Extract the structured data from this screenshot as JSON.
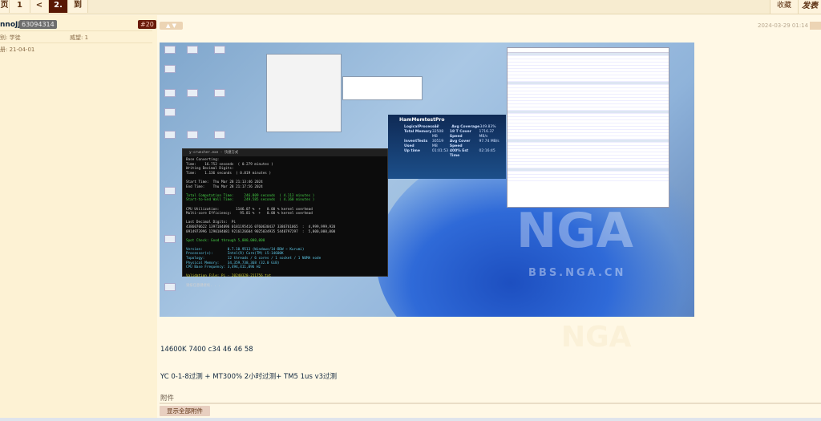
{
  "pagination": {
    "items": [
      {
        "label": "页"
      },
      {
        "label": "1"
      },
      {
        "label": "<"
      },
      {
        "label": "2.",
        "active": true
      },
      {
        "label": "到"
      }
    ]
  },
  "header_actions": {
    "favorite": "收藏",
    "post": "发表"
  },
  "post": {
    "author": {
      "name": "nnoJJ",
      "uid": "63094314",
      "rank_label": "别: 学徒",
      "prestige_label": "威望: 1",
      "reg_label": "册: 21-04-01"
    },
    "floor": "#20",
    "date": "2024-03-29 01:14",
    "image": {
      "watermark": "NGA",
      "watermark_url": "BBS.NGA.CN",
      "terminal_title": "y-cruncher.exe - 快捷方式",
      "terminal_lines": [
        {
          "t": "Base Converting:",
          "c": ""
        },
        {
          "t": "Time:    16.752 seconds  ( 0.279 minutes )",
          "c": ""
        },
        {
          "t": "Writing Decimal Digits:",
          "c": ""
        },
        {
          "t": "Time:    1.136 seconds  ( 0.019 minutes )",
          "c": ""
        },
        {
          "t": "",
          "c": ""
        },
        {
          "t": "Start Time:  Thu Mar 28 21:13:46 2024",
          "c": ""
        },
        {
          "t": "End Time:    Thu Mar 28 21:17:56 2024",
          "c": ""
        },
        {
          "t": "",
          "c": ""
        },
        {
          "t": "Total Computation Time:     246.809 seconds  ( 4.113 minutes )",
          "c": "g"
        },
        {
          "t": "Start-to-End Wall Time:     249.585 seconds  ( 4.160 minutes )",
          "c": "g"
        },
        {
          "t": "",
          "c": ""
        },
        {
          "t": "CPU Utilization:        1146.07 %  +   0.00 % kernel overhead",
          "c": ""
        },
        {
          "t": "Multi-core Efficiency:    95.81 %  +   0.00 % kernel overhead",
          "c": ""
        },
        {
          "t": "",
          "c": ""
        },
        {
          "t": "Last Decimal Digits:  Pi",
          "c": ""
        },
        {
          "t": "4386070622 1397184096 0181195416 0760630437 3386761065  :  4,999,999,920",
          "c": ""
        },
        {
          "t": "0914973996 1290184081 9216126604 9025034935 5440797297  :  5,000,000,000",
          "c": ""
        },
        {
          "t": "",
          "c": ""
        },
        {
          "t": "Spot Check: Good through 5,000,000,000",
          "c": "g"
        },
        {
          "t": "",
          "c": ""
        },
        {
          "t": "Version:            0.7.10.9513 (Windows/14-BDW ~ Kurumi)",
          "c": "c"
        },
        {
          "t": "Processor(s):       Intel(R) Core(TM) i5-14600K",
          "c": "c"
        },
        {
          "t": "Topology:           12 threads / 6 cores / 1 socket / 1 NUMA node",
          "c": "c"
        },
        {
          "t": "Physical Memory:    34,359,738,368 (32.0 GiB)",
          "c": "c"
        },
        {
          "t": "CPU Base Frequency: 3,494,411,096 Hz",
          "c": "c"
        },
        {
          "t": "",
          "c": ""
        },
        {
          "t": "Validation File: Pi - 20240328-211756.txt",
          "c": "y"
        },
        {
          "t": "",
          "c": ""
        },
        {
          "t": "请按任意键继续. . .",
          "c": ""
        }
      ],
      "hcm_title": "HamMemtestPro",
      "hcm_rows": [
        [
          "LogicalProcessor",
          "12",
          "Avg Coverage",
          "349.83%"
        ],
        [
          "Total Memory",
          "32508 MB",
          "18 T Cover Speed",
          "1716.37 MB/s"
        ],
        [
          "InventTests Used",
          "30519 MB",
          "Avg Cover Speed",
          "97.74 MB/s"
        ],
        [
          "Up time",
          "01:01:53",
          "400% Est Time",
          "02:16:45"
        ]
      ]
    },
    "content": [
      "14600K 7400 c34 46 46 58",
      "YC 0-1-8过测 + MT300% 2小时过测+ TM5 1us v3过测"
    ],
    "attachments": {
      "label": "附件",
      "show_all": "显示全部附件"
    }
  },
  "colors": {
    "page_bg": "#fff8e5",
    "active_page": "#591804",
    "floor_badge": "#6a1b0a"
  }
}
